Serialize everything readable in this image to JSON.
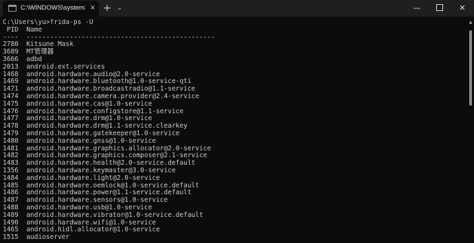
{
  "window": {
    "tab_title": "C:\\WINDOWS\\system32\\cmd.exe",
    "tab_close": "×",
    "new_tab": "+",
    "dropdown": "⌄",
    "minimize": "—",
    "close": "✕"
  },
  "console": {
    "lines": [
      "C:\\Users\\yu>frida-ps -U",
      " PID  Name",
      "----  ------------------------------------------------",
      "2780  Kitsune Mask",
      "3689  MT管理器",
      "3666  adbd",
      "2013  android.ext.services",
      "1468  android.hardware.audio@2.0-service",
      "1469  android.hardware.bluetooth@1.0-service-qti",
      "1471  android.hardware.broadcastradio@1.1-service",
      "1474  android.hardware.camera.provider@2.4-service",
      "1475  android.hardware.cas@1.0-service",
      "1476  android.hardware.configstore@1.1-service",
      "1477  android.hardware.drm@1.0-service",
      "1478  android.hardware.drm@1.1-service.clearkey",
      "1479  android.hardware.gatekeeper@1.0-service",
      "1480  android.hardware.gnss@1.0-service",
      "1481  android.hardware.graphics.allocator@2.0-service",
      "1482  android.hardware.graphics.composer@2.1-service",
      "1483  android.hardware.health@2.0-service.default",
      "1356  android.hardware.keymaster@3.0-service",
      "1484  android.hardware.light@2.0-service",
      "1485  android.hardware.oemlock@1.0-service.default",
      "1486  android.hardware.power@1.1-service.default",
      "1487  android.hardware.sensors@1.0-service",
      "1488  android.hardware.usb@1.0-service",
      "1489  android.hardware.vibrator@1.0-service.default",
      "1490  android.hardware.wifi@1.0-service",
      "1465  android.hidl.allocator@1.0-service",
      "1515  audioserver"
    ]
  },
  "colors": {
    "background": "#0c0c0c",
    "titlebar": "#1f1f1f",
    "text": "#cccccc"
  }
}
